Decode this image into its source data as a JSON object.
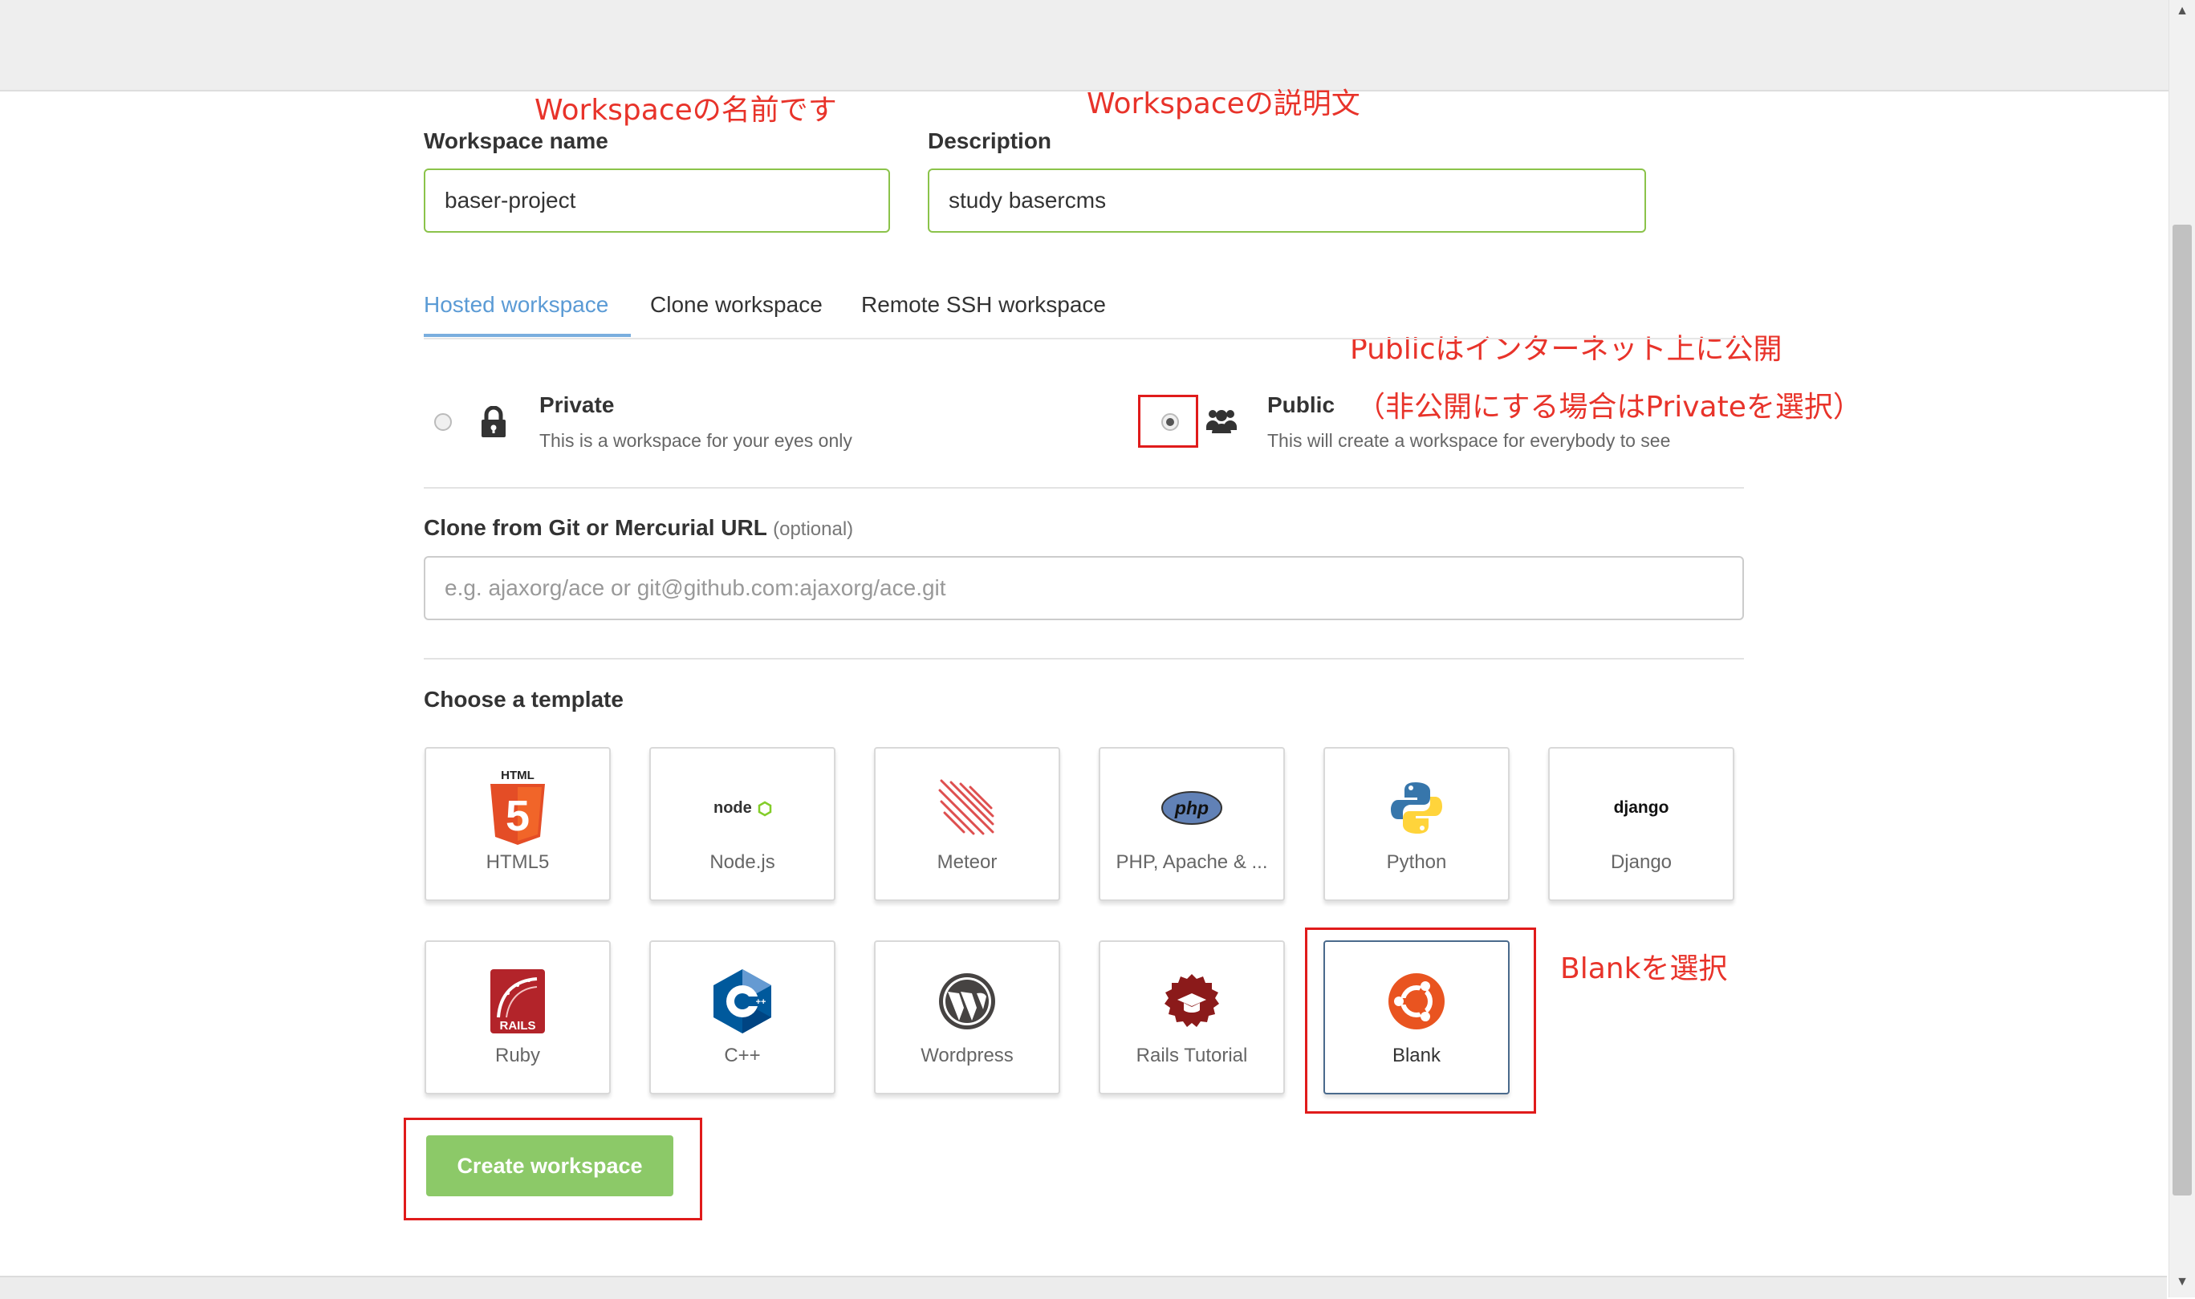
{
  "annotations": {
    "workspace_name_note": "Workspaceの名前です",
    "description_note": "Workspaceの説明文",
    "public_note_line1": "Publicはインターネット上に公開",
    "public_note_line2": "（非公開にする場合はPrivateを選択）",
    "blank_note": "Blankを選択"
  },
  "form": {
    "workspace_name_label": "Workspace name",
    "workspace_name_value": "baser-project",
    "description_label": "Description",
    "description_value": "study basercms"
  },
  "tabs": [
    {
      "label": "Hosted workspace",
      "active": true
    },
    {
      "label": "Clone workspace",
      "active": false
    },
    {
      "label": "Remote SSH workspace",
      "active": false
    }
  ],
  "visibility": {
    "private": {
      "title": "Private",
      "desc": "This is a workspace for your eyes only",
      "checked": false,
      "icon": "lock-icon"
    },
    "public": {
      "title": "Public",
      "desc": "This will create a workspace for everybody to see",
      "checked": true,
      "icon": "users-icon"
    }
  },
  "clone": {
    "label": "Clone from Git or Mercurial URL",
    "optional": "(optional)",
    "placeholder": "e.g. ajaxorg/ace or git@github.com:ajaxorg/ace.git"
  },
  "templates": {
    "label": "Choose a template",
    "items": [
      {
        "name": "HTML5",
        "icon": "html5-logo",
        "selected": false
      },
      {
        "name": "Node.js",
        "icon": "nodejs-logo",
        "selected": false
      },
      {
        "name": "Meteor",
        "icon": "meteor-logo",
        "selected": false
      },
      {
        "name": "PHP, Apache & ...",
        "icon": "php-logo",
        "selected": false
      },
      {
        "name": "Python",
        "icon": "python-logo",
        "selected": false
      },
      {
        "name": "Django",
        "icon": "django-logo",
        "selected": false
      },
      {
        "name": "Ruby",
        "icon": "rails-logo",
        "selected": false
      },
      {
        "name": "C++",
        "icon": "cpp-logo",
        "selected": false
      },
      {
        "name": "Wordpress",
        "icon": "wordpress-logo",
        "selected": false
      },
      {
        "name": "Rails Tutorial",
        "icon": "rails-tutorial-logo",
        "selected": false
      },
      {
        "name": "Blank",
        "icon": "ubuntu-logo",
        "selected": true
      }
    ]
  },
  "logo_text": {
    "html5": "HTML",
    "html5_num": "5",
    "nodejs": "node",
    "php": "php",
    "django": "django",
    "rails": "RAILS"
  },
  "create_button": "Create workspace",
  "colors": {
    "annotation": "#e8332a",
    "valid_border": "#8bc34a",
    "active_tab": "#5b9bd5",
    "create_button": "#8cc968"
  }
}
